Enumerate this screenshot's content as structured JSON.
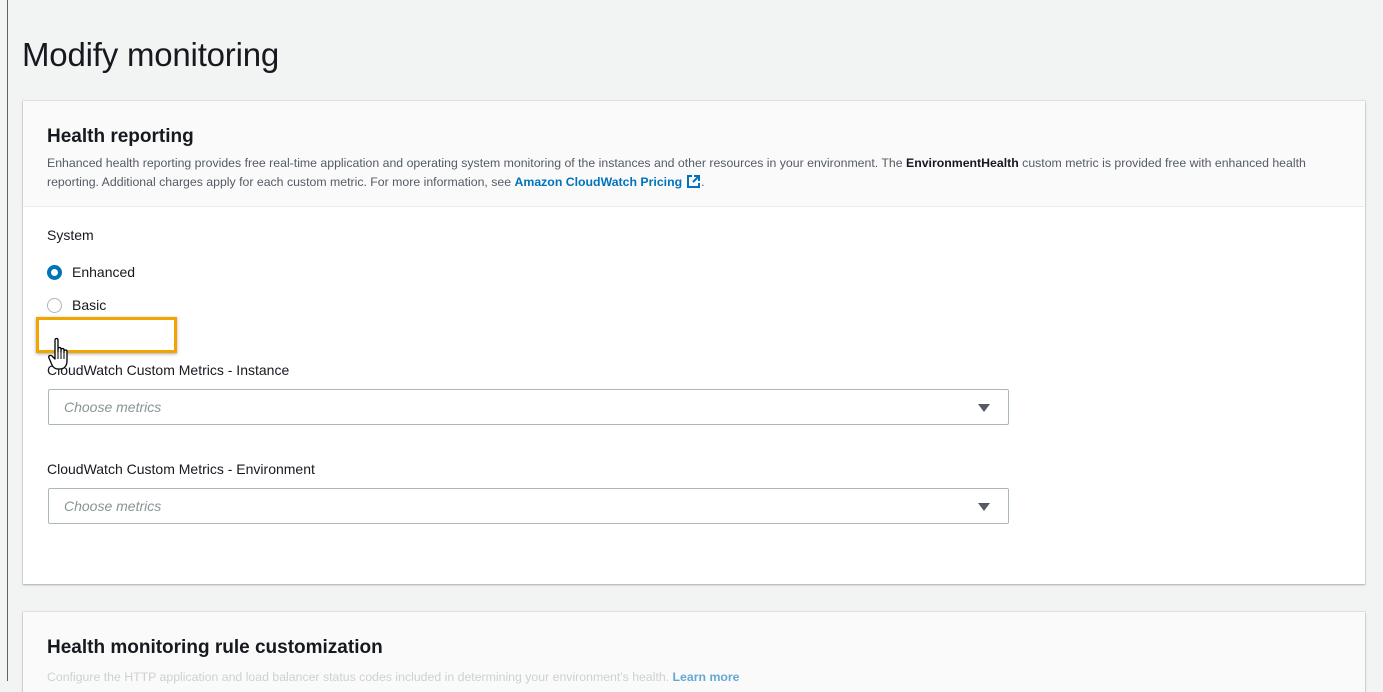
{
  "page": {
    "title": "Modify monitoring"
  },
  "health_reporting": {
    "title": "Health reporting",
    "desc_part1": "Enhanced health reporting provides free real-time application and operating system monitoring of the instances and other resources in your environment. The ",
    "desc_bold": "EnvironmentHealth",
    "desc_part2": " custom metric is provided free with enhanced health reporting. Additional charges apply for each custom metric. For more information, see ",
    "desc_link": "Amazon CloudWatch Pricing",
    "desc_end": ".",
    "system_label": "System",
    "options": [
      {
        "label": "Enhanced",
        "selected": true
      },
      {
        "label": "Basic",
        "selected": false
      }
    ],
    "instance_metrics": {
      "label": "CloudWatch Custom Metrics - Instance",
      "placeholder": "Choose metrics"
    },
    "environment_metrics": {
      "label": "CloudWatch Custom Metrics - Environment",
      "placeholder": "Choose metrics"
    }
  },
  "rule_customization": {
    "title": "Health monitoring rule customization",
    "desc": "Configure the HTTP application and load balancer status codes included in determining your environment's health.",
    "learn_more": "Learn more"
  },
  "colors": {
    "accent": "#0073bb",
    "highlight": "#f0a500"
  }
}
